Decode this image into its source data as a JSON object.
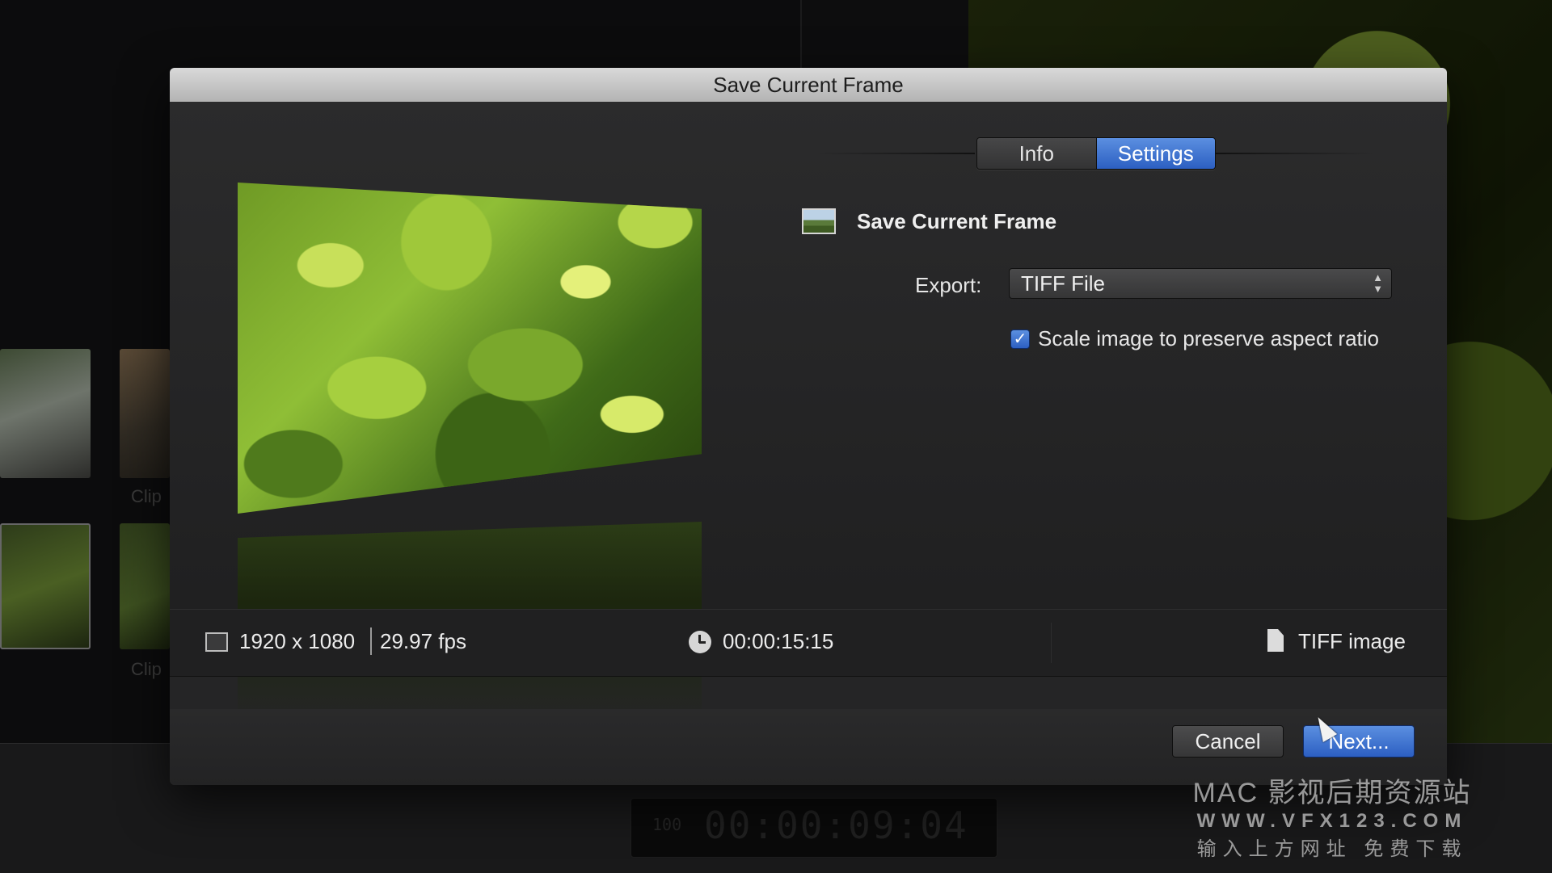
{
  "background": {
    "clip_labels": [
      "Clip",
      "Clip"
    ],
    "timecode_display": "00:00:09:04",
    "zoom_percent": "100"
  },
  "dialog": {
    "title": "Save Current Frame",
    "tabs": [
      {
        "label": "Info",
        "selected": false
      },
      {
        "label": "Settings",
        "selected": true
      }
    ],
    "settings": {
      "header_title": "Save Current Frame",
      "header_icon": "frame-thumbnail-icon",
      "export_label": "Export:",
      "export_value": "TIFF File",
      "scale_checkbox_checked": true,
      "scale_label": "Scale image to preserve aspect ratio"
    },
    "info_strip": {
      "frame_size": "1920 x 1080",
      "frame_rate": "29.97 fps",
      "duration": "00:00:15:15",
      "file_type": "TIFF image"
    },
    "buttons": {
      "cancel": "Cancel",
      "next": "Next..."
    }
  },
  "watermark": {
    "line1": "MAC 影视后期资源站",
    "line2": "WWW.VFX123.COM",
    "line3": "输入上方网址 免费下载"
  },
  "colors": {
    "accent": "#2c5fc2",
    "dialog_bg": "#252526",
    "titlebar": "#c4c4c4"
  }
}
